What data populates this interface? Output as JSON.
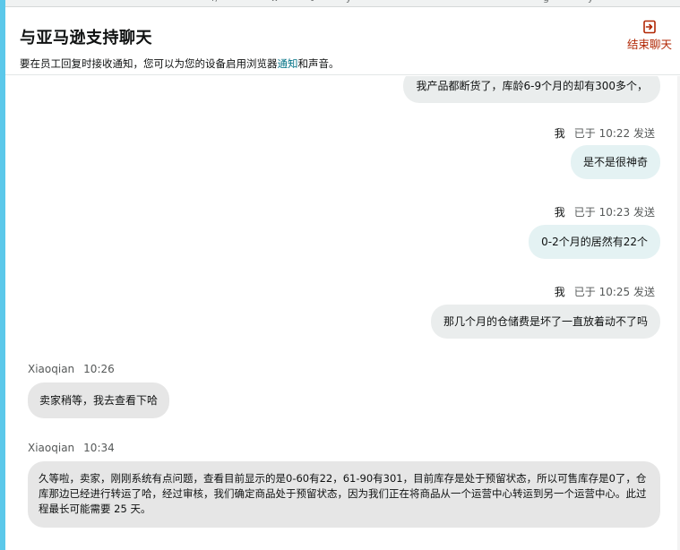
{
  "top_strip_fragments": [
    "r/",
    "w",
    "t",
    "y",
    "g",
    "y"
  ],
  "header": {
    "title": "与亚马逊支持聊天",
    "notice_before": "要在员工回复时接收通知，您可以为您的设备启用浏览器",
    "notice_link": "通知",
    "notice_after": "和声音。",
    "end_chat_label": "结束聊天",
    "end_chat_icon": "exit-icon"
  },
  "colors": {
    "accent_left": "#5bc8ea",
    "end_chat": "#b12704",
    "link": "#007185",
    "my_bubble": "#e4f2f3",
    "agent_bubble": "#e6e6e6"
  },
  "messages": [
    {
      "sender": "me",
      "text": "我产品都断货了，库龄6-9个月的却有300多个，"
    },
    {
      "sender": "me",
      "who": "我",
      "time": "已于 10:22 发送",
      "text": "是不是很神奇"
    },
    {
      "sender": "me",
      "who": "我",
      "time": "已于 10:23 发送",
      "text": "0-2个月的居然有22个"
    },
    {
      "sender": "me",
      "who": "我",
      "time": "已于 10:25 发送",
      "text": "那几个月的仓储费是坏了一直放着动不了吗"
    },
    {
      "sender": "agent",
      "who": "Xiaoqian",
      "time": "10:26",
      "text": "卖家稍等，我去查看下哈"
    },
    {
      "sender": "agent",
      "who": "Xiaoqian",
      "time": "10:34",
      "text": "久等啦，卖家，刚刚系统有点问题，查看目前显示的是0-60有22，61-90有301，目前库存是处于预留状态，所以可售库存是0了，仓库那边已经进行转运了哈，经过审核，我们确定商品处于预留状态，因为我们正在将商品从一个运营中心转运到另一个运营中心。此过程最长可能需要 25 天。"
    }
  ]
}
